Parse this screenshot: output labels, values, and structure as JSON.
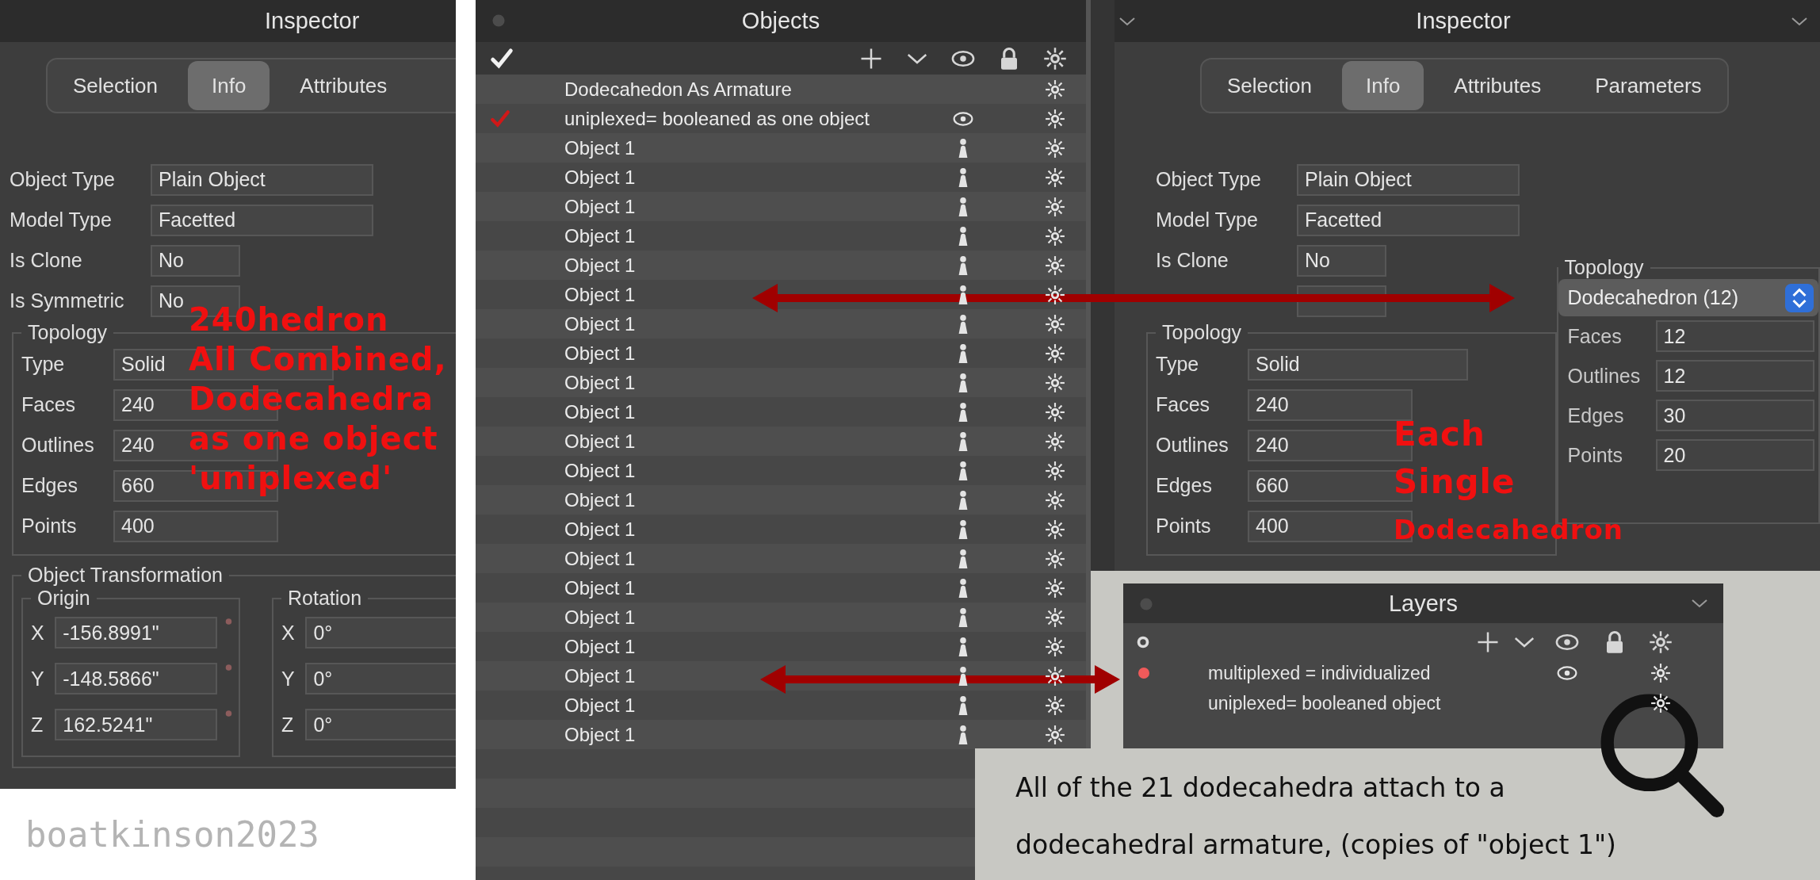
{
  "left_inspector": {
    "title": "Inspector",
    "tabs": [
      {
        "label": "Selection",
        "selected": false
      },
      {
        "label": "Info",
        "selected": true
      },
      {
        "label": "Attributes",
        "selected": false
      }
    ],
    "info": [
      {
        "label": "Object Type",
        "value": "Plain Object",
        "kind": "long"
      },
      {
        "label": "Model Type",
        "value": "Facetted",
        "kind": "long"
      },
      {
        "label": "Is Clone",
        "value": "No",
        "kind": "short"
      },
      {
        "label": "Is Symmetric",
        "value": "No",
        "kind": "short"
      }
    ],
    "topology": {
      "title": "Topology",
      "fields": [
        {
          "label": "Type",
          "value": "Solid",
          "kind": "long"
        },
        {
          "label": "Faces",
          "value": "240",
          "kind": "mid"
        },
        {
          "label": "Outlines",
          "value": "240",
          "kind": "mid"
        },
        {
          "label": "Edges",
          "value": "660",
          "kind": "mid"
        },
        {
          "label": "Points",
          "value": "400",
          "kind": "mid"
        }
      ]
    },
    "transformation": {
      "title": "Object Transformation",
      "origin": {
        "title": "Origin",
        "fields": [
          {
            "axis": "X",
            "value": "-156.8991\""
          },
          {
            "axis": "Y",
            "value": "-148.5866\""
          },
          {
            "axis": "Z",
            "value": "162.5241\""
          }
        ]
      },
      "rotation": {
        "title": "Rotation",
        "fields": [
          {
            "axis": "X",
            "value": "0°"
          },
          {
            "axis": "Y",
            "value": "0°"
          },
          {
            "axis": "Z",
            "value": "0°"
          }
        ]
      }
    },
    "annotation": {
      "lines": [
        "240hedron",
        "All Combined,",
        "Dodecahedra",
        "as one object",
        "'uniplexed'"
      ]
    }
  },
  "credit": "boatkinson2023",
  "objects": {
    "title": "Objects",
    "rows": [
      {
        "name": "Dodecahedon As Armature",
        "kind": "armature",
        "checked": false
      },
      {
        "name": "uniplexed= booleaned as one object",
        "kind": "group",
        "checked": true
      },
      {
        "name": "Object 1",
        "kind": "object",
        "checked": false
      },
      {
        "name": "Object 1",
        "kind": "object",
        "checked": false
      },
      {
        "name": "Object 1",
        "kind": "object",
        "checked": false
      },
      {
        "name": "Object 1",
        "kind": "object",
        "checked": false
      },
      {
        "name": "Object 1",
        "kind": "object",
        "checked": false
      },
      {
        "name": "Object 1",
        "kind": "object",
        "checked": false
      },
      {
        "name": "Object 1",
        "kind": "object",
        "checked": false
      },
      {
        "name": "Object 1",
        "kind": "object",
        "checked": false
      },
      {
        "name": "Object 1",
        "kind": "object",
        "checked": false
      },
      {
        "name": "Object 1",
        "kind": "object",
        "checked": false
      },
      {
        "name": "Object 1",
        "kind": "object",
        "checked": false
      },
      {
        "name": "Object 1",
        "kind": "object",
        "checked": false
      },
      {
        "name": "Object 1",
        "kind": "object",
        "checked": false
      },
      {
        "name": "Object 1",
        "kind": "object",
        "checked": false
      },
      {
        "name": "Object 1",
        "kind": "object",
        "checked": false
      },
      {
        "name": "Object 1",
        "kind": "object",
        "checked": false
      },
      {
        "name": "Object 1",
        "kind": "object",
        "checked": false
      },
      {
        "name": "Object 1",
        "kind": "object",
        "checked": false
      },
      {
        "name": "Object 1",
        "kind": "object",
        "checked": false
      },
      {
        "name": "Object 1",
        "kind": "object",
        "checked": false
      },
      {
        "name": "Object 1",
        "kind": "object",
        "checked": false
      }
    ]
  },
  "right_inspector": {
    "title": "Inspector",
    "tabs": [
      {
        "label": "Selection",
        "selected": false
      },
      {
        "label": "Info",
        "selected": true
      },
      {
        "label": "Attributes",
        "selected": false
      },
      {
        "label": "Parameters",
        "selected": false
      }
    ],
    "info": [
      {
        "label": "Object Type",
        "value": "Plain Object",
        "kind": "long"
      },
      {
        "label": "Model Type",
        "value": "Facetted",
        "kind": "long"
      },
      {
        "label": "Is Clone",
        "value": "No",
        "kind": "short"
      },
      {
        "kind": "covered"
      }
    ],
    "topology": {
      "title": "Topology",
      "fields": [
        {
          "label": "Type",
          "value": "Solid",
          "kind": "long"
        },
        {
          "label": "Faces",
          "value": "240",
          "kind": "mid"
        },
        {
          "label": "Outlines",
          "value": "240",
          "kind": "mid"
        },
        {
          "label": "Edges",
          "value": "660",
          "kind": "mid"
        },
        {
          "label": "Points",
          "value": "400",
          "kind": "mid"
        }
      ]
    },
    "element_topology": {
      "title": "Topology",
      "dropdown": "Dodecahedron (12)",
      "fields": [
        {
          "label": "Faces",
          "value": "12"
        },
        {
          "label": "Outlines",
          "value": "12"
        },
        {
          "label": "Edges",
          "value": "30"
        },
        {
          "label": "Points",
          "value": "20"
        }
      ]
    },
    "annotation": {
      "lines": [
        "Each",
        "Single",
        "Dodecahedron"
      ]
    }
  },
  "layers": {
    "title": "Layers",
    "rows": [
      {
        "name": "multiplexed = individualized",
        "active": true,
        "visible": true
      },
      {
        "name": "uniplexed= booleaned object",
        "active": false,
        "visible": false
      }
    ]
  },
  "caption": {
    "lines": [
      "All of the 21 dodecahedra attach to a",
      "dodecahedral armature, (copies of \"object 1\")"
    ]
  }
}
